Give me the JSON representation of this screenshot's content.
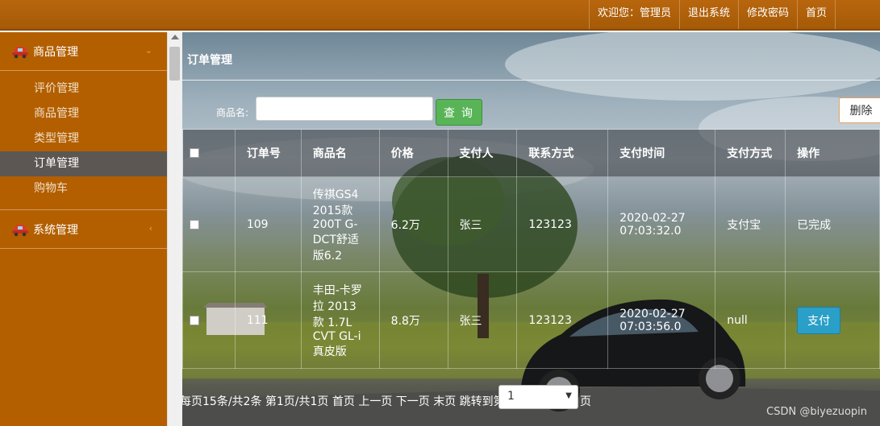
{
  "header": {
    "welcome": "欢迎您：管理员",
    "logout": "退出系统",
    "change_password": "修改密码",
    "home": "首页"
  },
  "sidebar": {
    "groups": [
      {
        "label": "商品管理",
        "icon": "car-icon",
        "chevron": "⌄",
        "items": [
          {
            "label": "评价管理"
          },
          {
            "label": "商品管理"
          },
          {
            "label": "类型管理"
          },
          {
            "label": "订单管理",
            "active": true
          },
          {
            "label": "购物车"
          }
        ]
      },
      {
        "label": "系统管理",
        "icon": "car-icon",
        "chevron": "‹"
      }
    ]
  },
  "main": {
    "title": "订单管理",
    "search": {
      "label": "商品名:",
      "value": "",
      "placeholder": ""
    },
    "search_button": "查 询",
    "delete_button": "删除",
    "table": {
      "headers": [
        "订单号",
        "商品名",
        "价格",
        "支付人",
        "联系方式",
        "支付时间",
        "支付方式",
        "操作"
      ],
      "rows": [
        {
          "order_no": "109",
          "product": "传祺GS4 2015款 200T G-DCT舒适版6.2",
          "price": "6.2万",
          "payer": "张三",
          "contact": "123123",
          "pay_time": "2020-02-27 07:03:32.0",
          "pay_method": "支付宝",
          "action": "已完成"
        },
        {
          "order_no": "111",
          "product": "丰田-卡罗拉 2013款 1.7L CVT GL-i真皮版",
          "price": "8.8万",
          "payer": "张三",
          "contact": "123123",
          "pay_time": "2020-02-27 07:03:56.0",
          "pay_method": "null",
          "action": "支付"
        }
      ]
    },
    "pager": {
      "text": "每页15条/共2条 第1页/共1页 首页 上一页 下一页 末页 跳转到第",
      "page_value": "1",
      "suffix": "页"
    }
  },
  "watermark": "CSDN @biyezuopin",
  "colors": {
    "topbar": "#a55a06",
    "sidebar": "#b35f00",
    "active_item": "#5c5753",
    "search_button": "#58b457",
    "pay_button": "#2a9fc7"
  }
}
